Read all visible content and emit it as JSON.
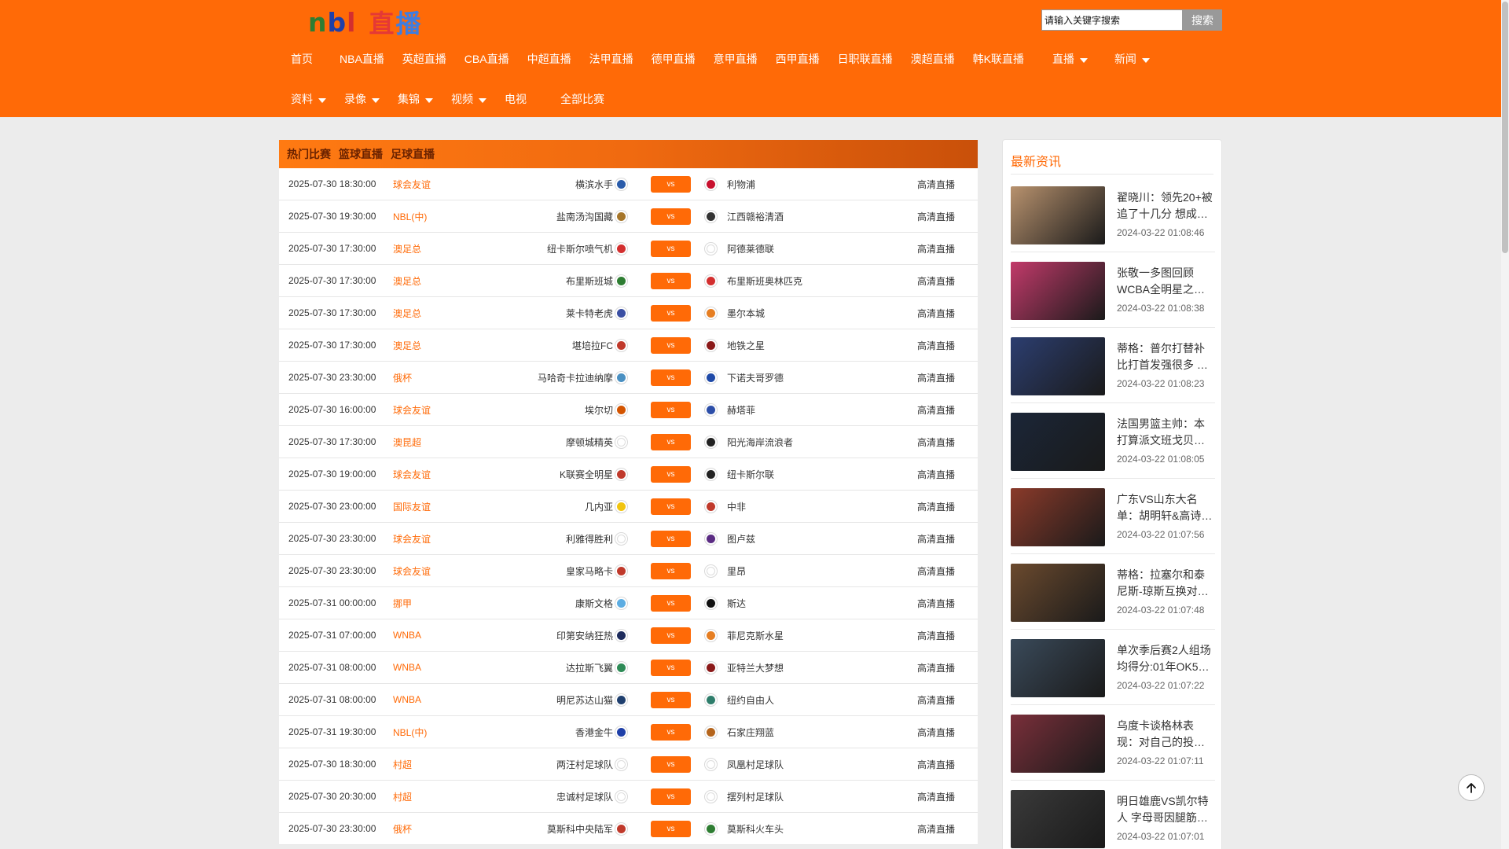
{
  "logo": {
    "part1": [
      "n",
      "b",
      "l"
    ],
    "part2": [
      "直",
      "播"
    ]
  },
  "search": {
    "placeholder": "请输入关键字搜索",
    "button": "搜索"
  },
  "nav_row1": [
    {
      "label": "首页",
      "caret": false
    },
    {
      "label": "NBA直播",
      "caret": false
    },
    {
      "label": "英超直播",
      "caret": false
    },
    {
      "label": "CBA直播",
      "caret": false
    },
    {
      "label": "中超直播",
      "caret": false
    },
    {
      "label": "法甲直播",
      "caret": false
    },
    {
      "label": "德甲直播",
      "caret": false
    },
    {
      "label": "意甲直播",
      "caret": false
    },
    {
      "label": "西甲直播",
      "caret": false
    },
    {
      "label": "日职联直播",
      "caret": false
    },
    {
      "label": "澳超直播",
      "caret": false
    },
    {
      "label": "韩K联直播",
      "caret": false
    },
    {
      "label": "直播",
      "caret": true
    },
    {
      "label": "新闻",
      "caret": true
    }
  ],
  "nav_row2": [
    {
      "label": "资料",
      "caret": true
    },
    {
      "label": "录像",
      "caret": true
    },
    {
      "label": "集锦",
      "caret": true
    },
    {
      "label": "视频",
      "caret": true
    },
    {
      "label": "电视",
      "caret": false
    },
    {
      "label": "全部比赛",
      "caret": false
    }
  ],
  "tabs": [
    "热门比赛",
    "篮球直播",
    "足球直播"
  ],
  "vs_label": "vs",
  "matches": [
    {
      "time": "2025-07-30 18:30:00",
      "league": "球会友谊",
      "home": "横滨水手",
      "away": "利物浦",
      "status": "高清直播",
      "home_color": "#2a5caa",
      "away_color": "#c8102e"
    },
    {
      "time": "2025-07-30 19:30:00",
      "league": "NBL(中)",
      "home": "盐南汤沟国藏",
      "away": "江西赣裕清酒",
      "status": "高清直播",
      "home_color": "#a6762a",
      "away_color": "#333333"
    },
    {
      "time": "2025-07-30 17:30:00",
      "league": "澳足总",
      "home": "纽卡斯尔喷气机",
      "away": "阿德莱德联",
      "status": "高清直播",
      "home_color": "#d32f2f",
      "away_color": "#ffffff"
    },
    {
      "time": "2025-07-30 17:30:00",
      "league": "澳足总",
      "home": "布里斯班城",
      "away": "布里斯班奥林匹克",
      "status": "高清直播",
      "home_color": "#2e7d32",
      "away_color": "#d32f2f"
    },
    {
      "time": "2025-07-30 17:30:00",
      "league": "澳足总",
      "home": "莱卡特老虎",
      "away": "墨尔本城",
      "status": "高清直播",
      "home_color": "#3b4fa3",
      "away_color": "#e67e22"
    },
    {
      "time": "2025-07-30 17:30:00",
      "league": "澳足总",
      "home": "堪培拉FC",
      "away": "地铁之星",
      "status": "高清直播",
      "home_color": "#c0392b",
      "away_color": "#8b1a1a"
    },
    {
      "time": "2025-07-30 23:30:00",
      "league": "俄杯",
      "home": "马哈奇卡拉迪纳摩",
      "away": "下诺夫哥罗德",
      "status": "高清直播",
      "home_color": "#4a90c2",
      "away_color": "#1f4aa8"
    },
    {
      "time": "2025-07-30 16:00:00",
      "league": "球会友谊",
      "home": "埃尔切",
      "away": "赫塔菲",
      "status": "高清直播",
      "home_color": "#d35400",
      "away_color": "#2c4ea8"
    },
    {
      "time": "2025-07-30 17:30:00",
      "league": "澳昆超",
      "home": "摩顿城精英",
      "away": "阳光海岸流浪者",
      "status": "高清直播",
      "home_color": "#ffffff",
      "away_color": "#222222"
    },
    {
      "time": "2025-07-30 19:00:00",
      "league": "球会友谊",
      "home": "K联赛全明星",
      "away": "纽卡斯尔联",
      "status": "高清直播",
      "home_color": "#c0392b",
      "away_color": "#222222"
    },
    {
      "time": "2025-07-30 23:00:00",
      "league": "国际友谊",
      "home": "几内亚",
      "away": "中非",
      "status": "高清直播",
      "home_color": "#f1c40f",
      "away_color": "#c0392b"
    },
    {
      "time": "2025-07-30 23:30:00",
      "league": "球会友谊",
      "home": "利雅得胜利",
      "away": "图卢兹",
      "status": "高清直播",
      "home_color": "#ffffff",
      "away_color": "#5b2c83"
    },
    {
      "time": "2025-07-30 23:30:00",
      "league": "球会友谊",
      "home": "皇家马略卡",
      "away": "里昂",
      "status": "高清直播",
      "home_color": "#c0392b",
      "away_color": "#ffffff"
    },
    {
      "time": "2025-07-31 00:00:00",
      "league": "挪甲",
      "home": "康斯文格",
      "away": "斯达",
      "status": "高清直播",
      "home_color": "#5dade2",
      "away_color": "#111111"
    },
    {
      "time": "2025-07-31 07:00:00",
      "league": "WNBA",
      "home": "印第安纳狂热",
      "away": "菲尼克斯水星",
      "status": "高清直播",
      "home_color": "#1d2b5c",
      "away_color": "#e67e22"
    },
    {
      "time": "2025-07-31 08:00:00",
      "league": "WNBA",
      "home": "达拉斯飞翼",
      "away": "亚特兰大梦想",
      "status": "高清直播",
      "home_color": "#2e8b57",
      "away_color": "#8b1a1a"
    },
    {
      "time": "2025-07-31 08:00:00",
      "league": "WNBA",
      "home": "明尼苏达山猫",
      "away": "纽约自由人",
      "status": "高清直播",
      "home_color": "#1f3f6e",
      "away_color": "#2e7d6b"
    },
    {
      "time": "2025-07-31 19:30:00",
      "league": "NBL(中)",
      "home": "香港金牛",
      "away": "石家庄翔蓝",
      "status": "高清直播",
      "home_color": "#1f3fa8",
      "away_color": "#b5651d"
    },
    {
      "time": "2025-07-30 18:30:00",
      "league": "村超",
      "home": "两汪村足球队",
      "away": "凤凰村足球队",
      "status": "高清直播",
      "home_color": "#ffffff",
      "away_color": "#ffffff"
    },
    {
      "time": "2025-07-30 20:30:00",
      "league": "村超",
      "home": "忠诚村足球队",
      "away": "摆列村足球队",
      "status": "高清直播",
      "home_color": "#ffffff",
      "away_color": "#ffffff"
    },
    {
      "time": "2025-07-30 23:30:00",
      "league": "俄杯",
      "home": "莫斯科中央陆军",
      "away": "莫斯科火车头",
      "status": "高清直播",
      "home_color": "#c0392b",
      "away_color": "#2e7d32"
    }
  ],
  "sidebar": {
    "title": "最新资讯",
    "news": [
      {
        "title": "翟晓川：领先20+被追了十几分 想成…",
        "date": "2024-03-22 01:08:46",
        "thumb_color": "#b8926e"
      },
      {
        "title": "张敬一多图回顾WCBA全明星之…",
        "date": "2024-03-22 01:08:38",
        "thumb_color": "#c23a6a"
      },
      {
        "title": "蒂格：普尔打替补比打首发强很多 …",
        "date": "2024-03-22 01:08:23",
        "thumb_color": "#2c3e70"
      },
      {
        "title": "法国男篮主帅：本打算派文班戈贝…",
        "date": "2024-03-22 01:08:05",
        "thumb_color": "#1b2638"
      },
      {
        "title": "广东VS山东大名单：胡明轩&高诗…",
        "date": "2024-03-22 01:07:56",
        "thumb_color": "#8a3a2a"
      },
      {
        "title": "蒂格：拉塞尔和泰尼斯-琼斯互换对…",
        "date": "2024-03-22 01:07:48",
        "thumb_color": "#6b4a2e"
      },
      {
        "title": "单次季后赛2人组场均得分:01年OK5…",
        "date": "2024-03-22 01:07:22",
        "thumb_color": "#3a4a5a"
      },
      {
        "title": "乌度卡谈格林表现：对自己的投…",
        "date": "2024-03-22 01:07:11",
        "thumb_color": "#7a2f3a"
      },
      {
        "title": "明日雄鹿VS凯尔特人 字母哥因腿筋…",
        "date": "2024-03-22 01:07:01",
        "thumb_color": "#3a3a3a"
      }
    ]
  }
}
